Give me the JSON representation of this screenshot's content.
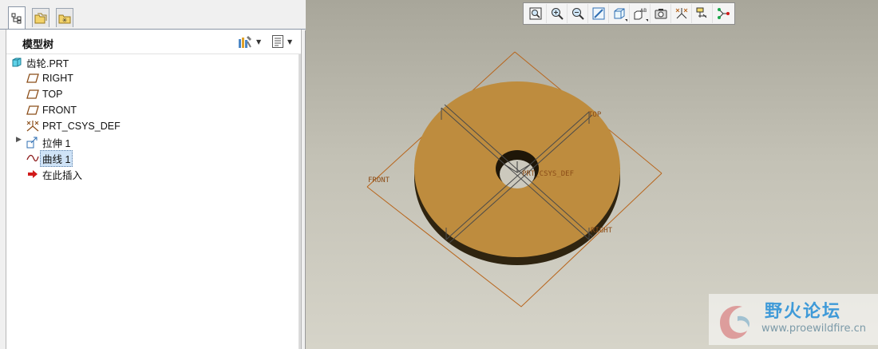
{
  "left_panel": {
    "tabs": [
      {
        "icon": "model-tree-tab-icon",
        "active": true
      },
      {
        "icon": "folder-browser-tab-icon",
        "active": false
      },
      {
        "icon": "favorites-tab-icon",
        "active": false
      }
    ],
    "tree_header": {
      "title": "模型树",
      "settings_icon": "tree-settings-icon",
      "show_icon": "tree-show-icon"
    },
    "tree": [
      {
        "label": "齿轮.PRT",
        "icon": "part-icon"
      },
      {
        "label": "RIGHT",
        "icon": "datum-plane-icon"
      },
      {
        "label": "TOP",
        "icon": "datum-plane-icon"
      },
      {
        "label": "FRONT",
        "icon": "datum-plane-icon"
      },
      {
        "label": "PRT_CSYS_DEF",
        "icon": "csys-icon"
      },
      {
        "label": "拉伸 1",
        "icon": "extrude-icon",
        "expandable": true
      },
      {
        "label": "曲线 1",
        "icon": "curve-icon",
        "selected": true
      },
      {
        "label": "在此插入",
        "icon": "insert-here-arrow-icon"
      }
    ]
  },
  "viewport": {
    "toolbar": [
      {
        "name": "refit-icon"
      },
      {
        "name": "zoom-in-icon"
      },
      {
        "name": "zoom-out-icon"
      },
      {
        "name": "repaint-icon"
      },
      {
        "name": "display-style-icon"
      },
      {
        "name": "saved-views-icon"
      },
      {
        "name": "named-view-icon"
      },
      {
        "name": "datum-display-icon"
      },
      {
        "name": "annotation-display-icon"
      },
      {
        "name": "spin-center-icon"
      }
    ],
    "datum_labels": {
      "front": "FRONT",
      "top": "TOP",
      "right": "RIGHT",
      "csys": "PRT_CSYS_DEF"
    },
    "colors": {
      "gear_top": "#be8c3e",
      "gear_side": "#2f2410",
      "datum": "#b8651c"
    },
    "watermark": {
      "title": "野火论坛",
      "url": "www.proewildfire.cn"
    }
  }
}
